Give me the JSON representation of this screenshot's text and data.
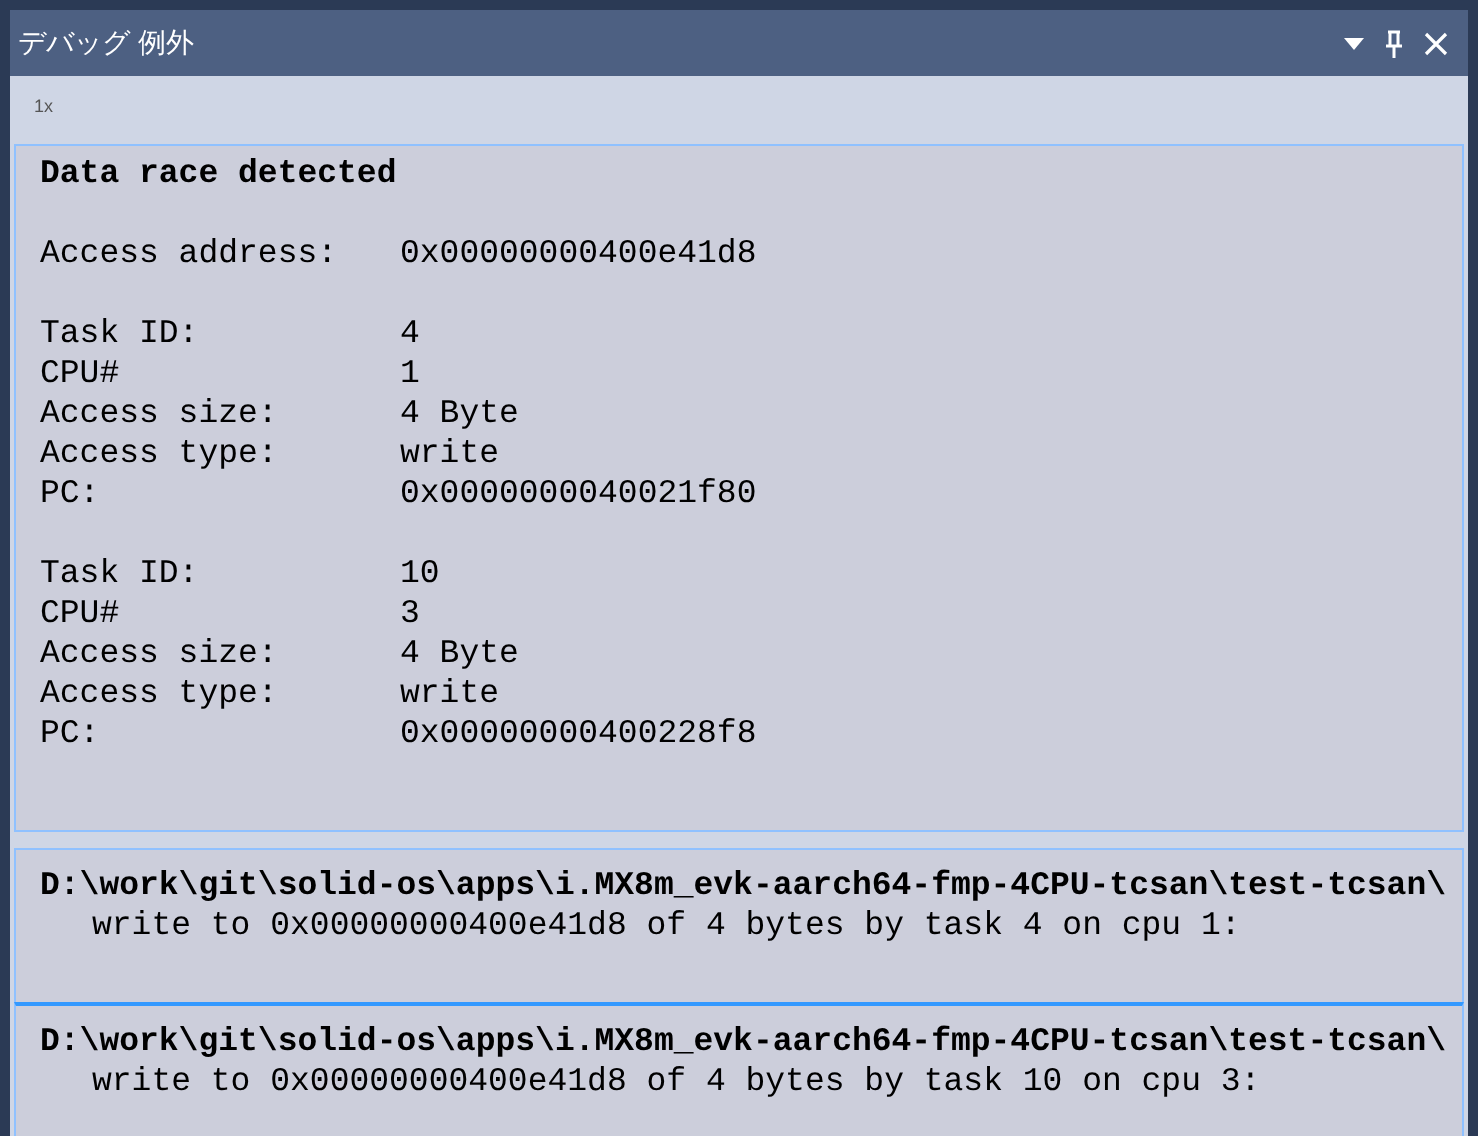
{
  "window": {
    "title": "デバッグ 例外"
  },
  "toolbar": {
    "label": "1x"
  },
  "details": {
    "title": "Data race detected",
    "groups": [
      [
        {
          "label": "Access address:",
          "value": "0x00000000400e41d8"
        }
      ],
      [
        {
          "label": "Task ID:",
          "value": "4"
        },
        {
          "label": "CPU#",
          "value": "1"
        },
        {
          "label": "Access size:",
          "value": "4 Byte"
        },
        {
          "label": "Access type:",
          "value": "write"
        },
        {
          "label": "PC:",
          "value": "0x0000000040021f80"
        }
      ],
      [
        {
          "label": "Task ID:",
          "value": "10"
        },
        {
          "label": "CPU#",
          "value": "3"
        },
        {
          "label": "Access size:",
          "value": "4 Byte"
        },
        {
          "label": "Access type:",
          "value": "write"
        },
        {
          "label": "PC:",
          "value": "0x00000000400228f8"
        }
      ]
    ]
  },
  "entries": [
    {
      "path": "D:\\work\\git\\solid-os\\apps\\i.MX8m_evk-aarch64-fmp-4CPU-tcsan\\test-tcsan\\",
      "message": "write to 0x00000000400e41d8 of 4 bytes by task 4 on cpu 1:",
      "selected": false
    },
    {
      "path": "D:\\work\\git\\solid-os\\apps\\i.MX8m_evk-aarch64-fmp-4CPU-tcsan\\test-tcsan\\",
      "message": "write to 0x00000000400e41d8 of 4 bytes by task 10 on cpu 3:",
      "selected": true
    }
  ]
}
